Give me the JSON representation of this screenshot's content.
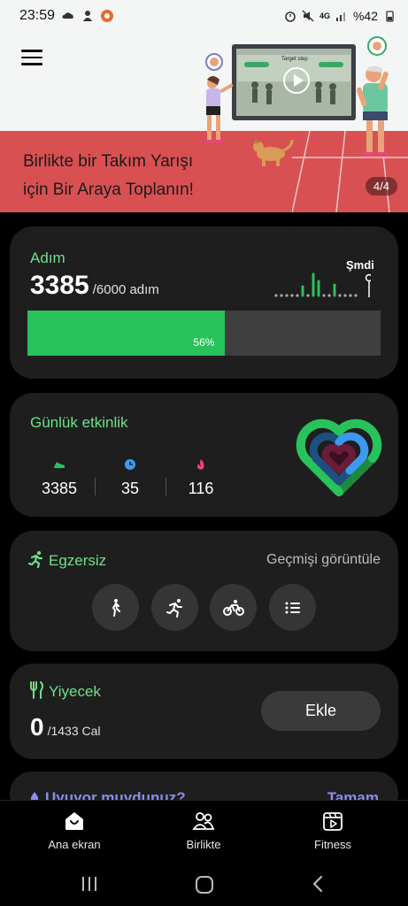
{
  "status_bar": {
    "time": "23:59",
    "signal_text": "4G",
    "battery": "%42",
    "icons": [
      "cloud-icon",
      "person-icon",
      "app-notification-icon",
      "alarm-icon",
      "mute-icon",
      "signal-icon",
      "battery-icon"
    ]
  },
  "banner": {
    "title_line1": "Birlikte bir Takım Yarışı",
    "title_line2": "için Bir Araya Toplanın!",
    "page_indicator": "4/4",
    "screen_caption": "Target step",
    "menu_icon": "hamburger-icon"
  },
  "steps": {
    "title": "Adım",
    "value": "3385",
    "goal": "/6000 adım",
    "now_label": "Şmdi",
    "progress": 0.56,
    "progress_label": "56%",
    "accent": "#27c25a"
  },
  "activity": {
    "title": "Günlük etkinlik",
    "stats": [
      {
        "icon": "shoe-icon",
        "value": "3385",
        "color": "#27c25a"
      },
      {
        "icon": "clock-icon",
        "value": "35",
        "color": "#3b9af0"
      },
      {
        "icon": "flame-icon",
        "value": "116",
        "color": "#e8467c"
      }
    ],
    "ring_colors": [
      "#27c25a",
      "#3b9af0",
      "#e8467c"
    ]
  },
  "exercise": {
    "title": "Egzersiz",
    "history": "Geçmişi görüntüle",
    "buttons": [
      "walking-icon",
      "running-icon",
      "cycling-icon",
      "list-icon"
    ]
  },
  "food": {
    "title": "Yiyecek",
    "value": "0",
    "goal": "/1433 Cal",
    "add_label": "Ekle"
  },
  "sleep": {
    "title": "Uyuyor muydunuz?",
    "action": "Tamam"
  },
  "bottom_nav": {
    "items": [
      {
        "label": "Ana ekran",
        "icon": "home-icon"
      },
      {
        "label": "Birlikte",
        "icon": "people-icon"
      },
      {
        "label": "Fitness",
        "icon": "fitness-video-icon"
      }
    ]
  },
  "system_nav": [
    "recents-icon",
    "home-circle-icon",
    "back-icon"
  ]
}
